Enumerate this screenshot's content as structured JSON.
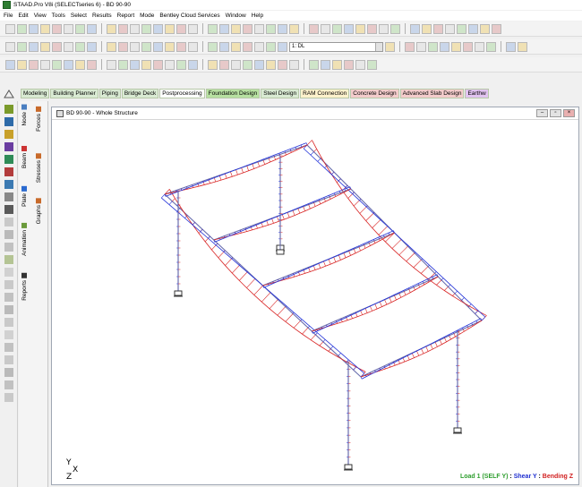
{
  "window": {
    "title": "STAAD.Pro V8i (SELECTseries 6) - BD 90-90"
  },
  "menu": [
    "File",
    "Edit",
    "View",
    "Tools",
    "Select",
    "Results",
    "Report",
    "Mode",
    "Bentley Cloud Services",
    "Window",
    "Help"
  ],
  "toolbar": {
    "load_combo": "1: DL"
  },
  "pages": [
    {
      "label": "Modeling",
      "bg": "#d9ead3"
    },
    {
      "label": "Building Planner",
      "bg": "#d9ead3"
    },
    {
      "label": "Piping",
      "bg": "#d9ead3"
    },
    {
      "label": "Bridge Deck",
      "bg": "#d9ead3"
    },
    {
      "label": "Postprocessing",
      "bg": "#ffffff"
    },
    {
      "label": "Foundation Design",
      "bg": "#b7e1a1"
    },
    {
      "label": "Steel Design",
      "bg": "#d9ead3"
    },
    {
      "label": "RAM Connection",
      "bg": "#fff2cc"
    },
    {
      "label": "Concrete Design",
      "bg": "#f4cccc"
    },
    {
      "label": "Advanced Slab Design",
      "bg": "#f4cccc"
    },
    {
      "label": "Earthw",
      "bg": "#e1c3f0"
    }
  ],
  "page_tree": {
    "col1": [
      "Node",
      "Beam",
      "Plate",
      "Animation",
      "Reports"
    ],
    "col2": [
      "Forces",
      "Stresses",
      "Graphs"
    ]
  },
  "view": {
    "title": "BD 90-90 - Whole Structure",
    "axis": {
      "y": "Y",
      "x": "X",
      "z": "Z"
    },
    "legend": [
      {
        "text": "Load 1 (SELF Y)",
        "color": "#2e9e2e"
      },
      {
        "text": " : ",
        "color": "#000000"
      },
      {
        "text": "Shear Y",
        "color": "#1f2fd0"
      },
      {
        "text": " : ",
        "color": "#000000"
      },
      {
        "text": "Bending Z",
        "color": "#d12020"
      }
    ]
  },
  "colors": {
    "shear": "#2232d8",
    "bending": "#d82323",
    "member": "#6a6fae",
    "accent_green": "#2e9e2e"
  }
}
